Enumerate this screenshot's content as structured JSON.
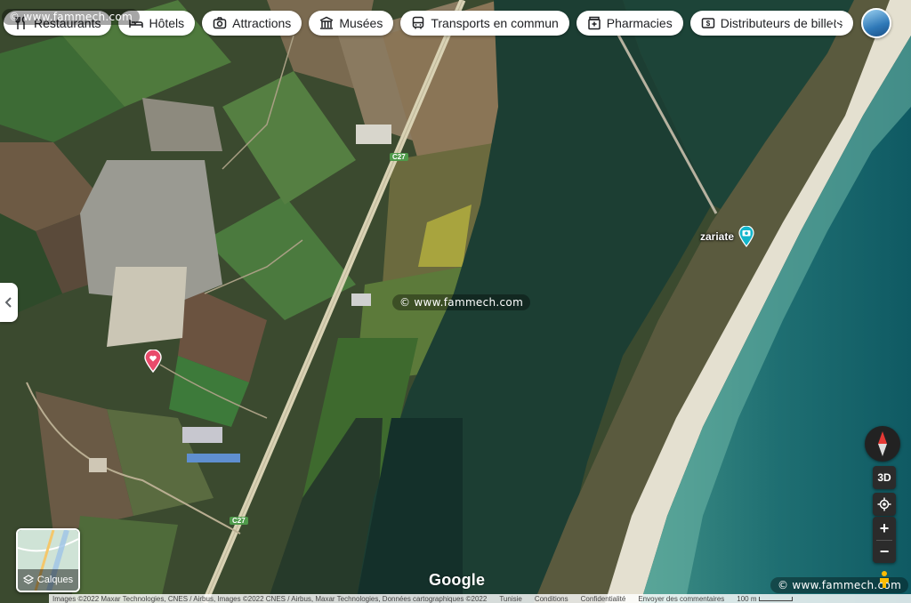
{
  "watermark": "© www.fammech.com",
  "categories": [
    {
      "label": "Restaurants",
      "icon": "fork-knife-icon"
    },
    {
      "label": "Hôtels",
      "icon": "bed-icon"
    },
    {
      "label": "Attractions",
      "icon": "camera-icon"
    },
    {
      "label": "Musées",
      "icon": "museum-icon"
    },
    {
      "label": "Transports en commun",
      "icon": "bus-icon"
    },
    {
      "label": "Pharmacies",
      "icon": "pharmacy-icon"
    },
    {
      "label": "Distributeurs de billets",
      "icon": "cash-icon"
    }
  ],
  "map": {
    "poi": {
      "label": "zariate",
      "icon": "camera-pin-icon"
    },
    "road_label": "C27",
    "pin_color": "#e94b6b"
  },
  "controls": {
    "three_d": "3D",
    "zoom_in": "+",
    "zoom_out": "−",
    "layers_label": "Calques"
  },
  "branding": "Google",
  "footer": {
    "attribution": "Images ©2022 Maxar Technologies, CNES / Airbus, Images ©2022 CNES / Airbus, Maxar Technologies, Données cartographiques ©2022",
    "region": "Tunisie",
    "terms": "Conditions",
    "privacy": "Confidentialité",
    "feedback": "Envoyer des commentaires",
    "scale": "100 m"
  }
}
